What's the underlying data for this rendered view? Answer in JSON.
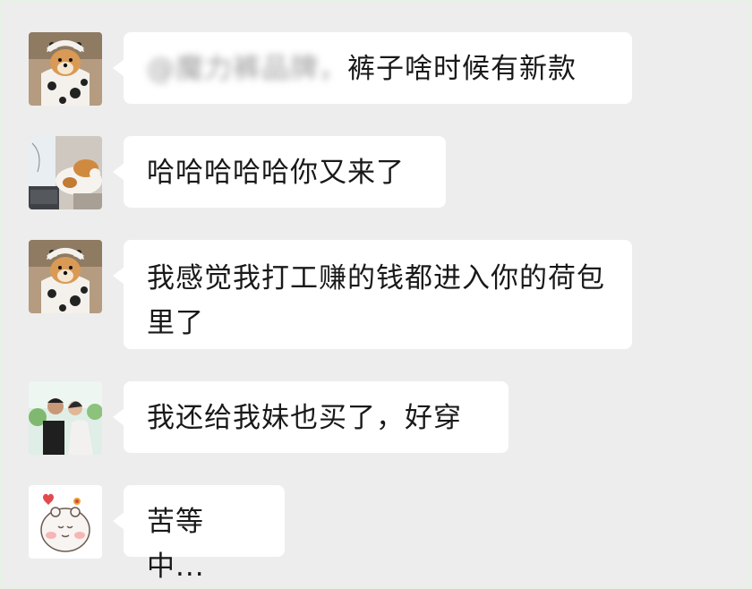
{
  "messages": [
    {
      "avatar": "shiba-dog-avatar",
      "mention": "@魔力裤品牌，",
      "text": "裤子啥时候有新款"
    },
    {
      "avatar": "cat-laptop-avatar",
      "text": "哈哈哈哈哈你又来了"
    },
    {
      "avatar": "shiba-dog-avatar",
      "text": "我感觉我打工赚的钱都进入你的荷包里了"
    },
    {
      "avatar": "couple-photo-avatar",
      "text": "我还给我妹也买了，好穿"
    },
    {
      "avatar": "cartoon-bear-avatar",
      "text": "苦等中..."
    }
  ]
}
